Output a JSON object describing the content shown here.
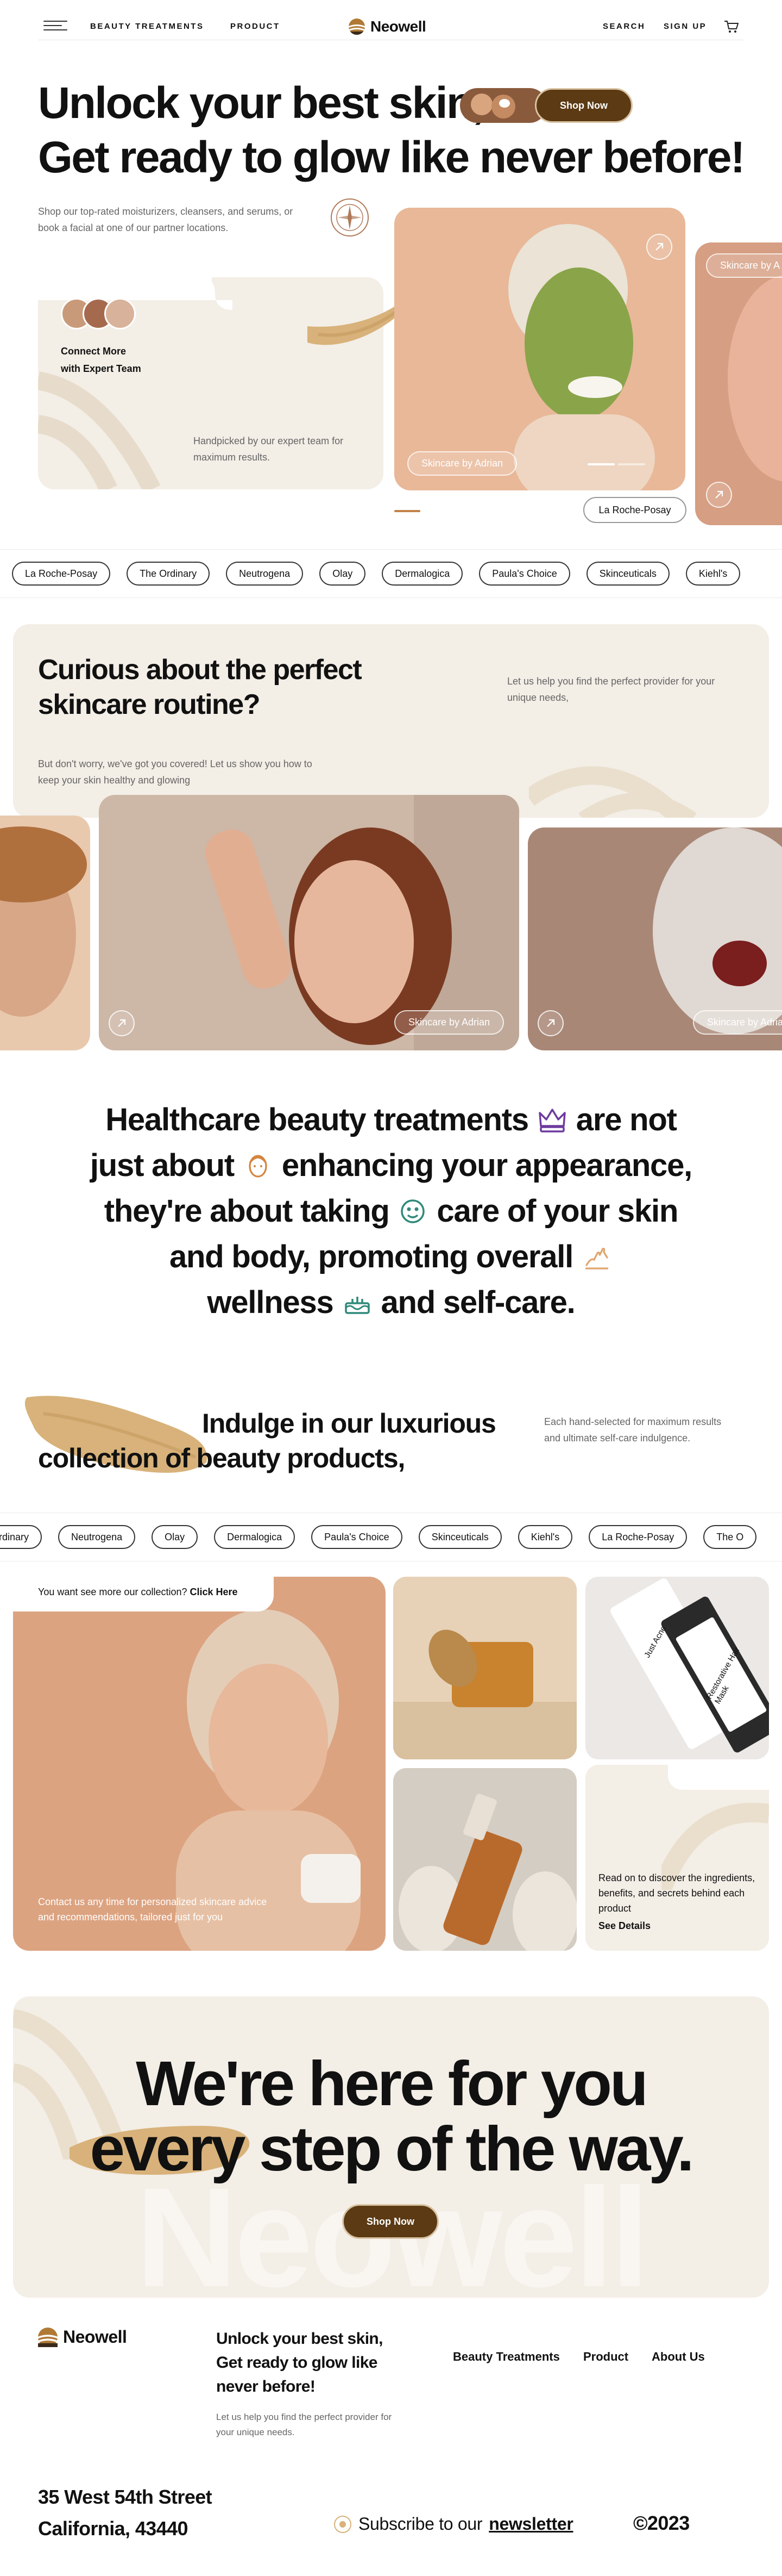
{
  "header": {
    "nav": [
      "BEAUTY TREATMENTS",
      "PRODUCT"
    ],
    "logo": "Neowell",
    "actions": [
      "SEARCH",
      "SIGN UP"
    ]
  },
  "hero": {
    "line1": "Unlock your best skin,",
    "line2": "Get ready to glow like never before!",
    "shop_button": "Shop Now",
    "subtitle": "Shop our top-rated moisturizers, cleansers, and serums, or book a facial at one of our partner locations.",
    "team_title_1": "Connect More",
    "team_title_2": "with Expert Team",
    "team_subtitle": "Handpicked by our expert team for maximum results.",
    "photo_tag": "Skincare by Adrian",
    "side_tag": "Skincare by A",
    "brand_tag": "La Roche-Posay"
  },
  "brands_row_1": [
    "La Roche-Posay",
    "The Ordinary",
    "Neutrogena",
    "Olay",
    "Dermalogica",
    "Paula's Choice",
    "Skinceuticals",
    "Kiehl's"
  ],
  "routine": {
    "title_1": "Curious about the perfect",
    "title_2": "skincare routine?",
    "subtitle": "But don't worry, we've got you covered! Let us show you how to keep your skin healthy and glowing",
    "help": "Let us help you find the perfect provider for your unique needs,",
    "tag_1": "Skincare by Adrian",
    "tag_2": "Skincare by Adrian"
  },
  "mission": {
    "l1a": "Healthcare beauty treatments",
    "l1b": "are not",
    "l2a": "just about",
    "l2b": "enhancing your appearance,",
    "l3a": "they're about taking",
    "l3b": "care of your skin",
    "l4a": "and body, promoting overall",
    "l5a": "wellness",
    "l5b": "and self-care."
  },
  "collection": {
    "title_1": "Indulge in our luxurious",
    "title_2": "collection of beauty products,",
    "note": "Each hand-selected for maximum results and ultimate self-care indulgence.",
    "more_prefix": "You want see more our collection?",
    "more_link": "Click Here",
    "contact": "Contact us any time for personalized skincare advice and recommendations, tailored just for you",
    "read_text": "Read on to discover the ingredients, benefits, and secrets behind each product",
    "see_details": "See Details",
    "tube_text_1": "Just Acne",
    "tube_text_2": "Restorative Hair Mask"
  },
  "brands_row_2": [
    "Ordinary",
    "Neutrogena",
    "Olay",
    "Dermalogica",
    "Paula's Choice",
    "Skinceuticals",
    "Kiehl's",
    "La Roche-Posay",
    "The O"
  ],
  "cta": {
    "line1": "We're here for you",
    "line2": "every step of the way.",
    "button": "Shop Now",
    "bg_word": "Neowell"
  },
  "footer": {
    "logo": "Neowell",
    "title": "Unlock your best skin, Get ready to glow like never before!",
    "subtitle": "Let us help you find the perfect provider for your unique needs.",
    "links": [
      "Beauty Treatments",
      "Product",
      "About Us"
    ],
    "address_1": "35 West 54th Street",
    "address_2": "California, 43440",
    "subscribe_prefix": "Subscribe to our",
    "subscribe_link": "newsletter",
    "copyright": "©2023"
  },
  "colors": {
    "accent_brown": "#5b3a14",
    "cream": "#f3eee6",
    "swatch": "#d8b27a",
    "icon_purple": "#6d3b9e",
    "icon_teal": "#2f8a7a",
    "icon_orange": "#d5843c"
  },
  "icons": [
    "menu-icon",
    "cart-icon",
    "compass-icon",
    "arrow-up-right-icon",
    "crown-icon",
    "face-icon",
    "face-mask-icon",
    "hands-icon",
    "cake-icon",
    "sun-icon"
  ]
}
